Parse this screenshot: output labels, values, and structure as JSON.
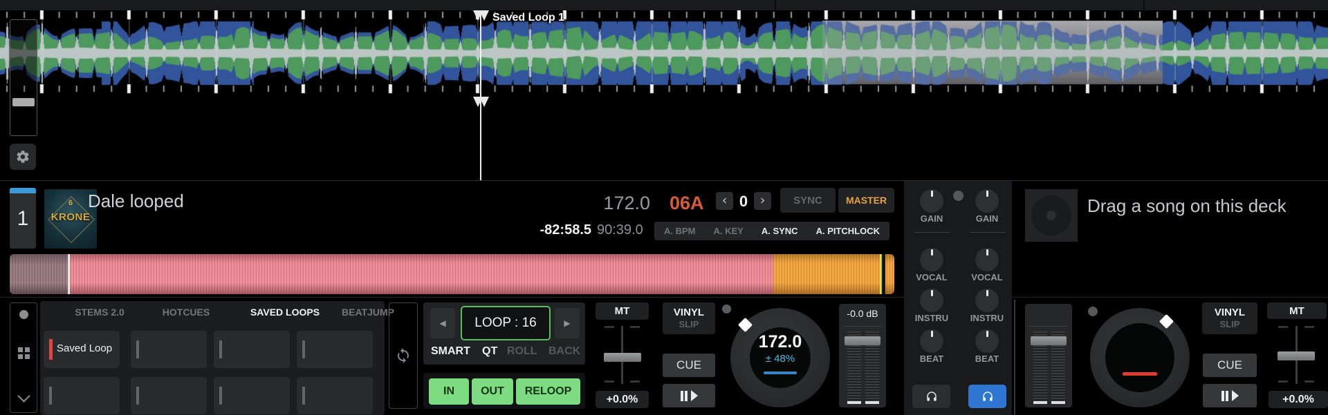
{
  "waveform": {
    "loop_label": "Saved Loop 1"
  },
  "deck1": {
    "number": "1",
    "art_text": "KRONE",
    "art_num": "6",
    "title": "Dale looped",
    "bpm": "172.0",
    "key": "06A",
    "key_shift": "0",
    "sync": "SYNC",
    "master": "MASTER",
    "time_remaining": "-82:58.5",
    "time_total": "90:39.0",
    "auto_buttons": [
      {
        "label": "A. BPM",
        "active": false
      },
      {
        "label": "A. KEY",
        "active": false
      },
      {
        "label": "A. SYNC",
        "active": true
      },
      {
        "label": "A. PITCHLOCK",
        "active": true
      }
    ],
    "tabs": [
      {
        "label": "STEMS 2.0",
        "active": false
      },
      {
        "label": "HOTCUES",
        "active": false
      },
      {
        "label": "SAVED LOOPS",
        "active": true
      },
      {
        "label": "BEATJUMP",
        "active": false
      }
    ],
    "pads": [
      {
        "label": "Saved Loop"
      }
    ],
    "loop": {
      "display": "LOOP : 16",
      "modes": [
        {
          "label": "SMART",
          "active": true
        },
        {
          "label": "QT",
          "active": true
        },
        {
          "label": "ROLL",
          "active": false
        },
        {
          "label": "BACK",
          "active": false
        }
      ],
      "in": "IN",
      "out": "OUT",
      "reloop": "RELOOP"
    },
    "mt": "MT",
    "pitch_value": "+0.0%",
    "vinyl": "VINYL",
    "slip": "SLIP",
    "cue": "CUE",
    "jog_bpm": "172.0",
    "jog_range": "± 48%",
    "level_db": "-0.0 dB"
  },
  "mixer": {
    "channel1_knobs": [
      "GAIN",
      "VOCAL",
      "INSTRU",
      "BEAT"
    ],
    "channel2_knobs": [
      "GAIN",
      "VOCAL",
      "INSTRU",
      "BEAT"
    ]
  },
  "deck2": {
    "placeholder": "Drag a song on this deck",
    "vinyl": "VINYL",
    "slip": "SLIP",
    "cue": "CUE",
    "mt": "MT",
    "pitch_value": "+0.0%"
  },
  "icons": {
    "prev_key": "‹",
    "next_key": "›",
    "loop_halve": "◀",
    "loop_double": "▶"
  },
  "colors": {
    "accent_green": "#7ddc82",
    "loop_border_green": "#57bd5f",
    "accent_cyan": "#48bce4",
    "master_orange": "#e8a33c",
    "key_orange_red": "#d95b36",
    "headphone_active_blue": "#2f76d2",
    "overview_pink": "#ef8b96",
    "overview_orange": "#f5a63f",
    "deck_blue_bar": "#3e9bd6",
    "pad_marker_red": "#e84343",
    "waveform_green": "#4e9a5e",
    "waveform_blue": "#32549a"
  }
}
